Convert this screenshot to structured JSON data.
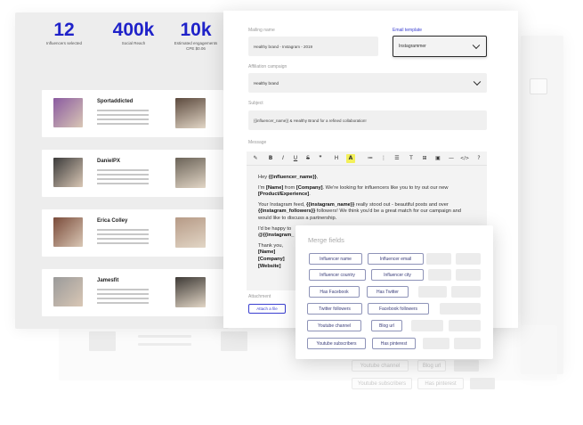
{
  "stats": [
    {
      "value": "12",
      "label": "Influencers selected"
    },
    {
      "value": "400k",
      "label": "Social Reach"
    },
    {
      "value": "10k",
      "label": "Estimated engagements"
    },
    {
      "value": "",
      "label": "CPE $0.06"
    }
  ],
  "influencers": [
    {
      "name": "Sportaddicted",
      "photo_color": "#8a5aa0",
      "post_color": "#5c4a3e"
    },
    {
      "name": "DanielPX",
      "photo_color": "#3b3b3b",
      "post_color": "#6b6358"
    },
    {
      "name": "Erica Colley",
      "photo_color": "#7a4b3a",
      "post_color": "#b69a86"
    },
    {
      "name": "Jamesfit",
      "photo_color": "#9a9a9a",
      "post_color": "#3e3a36"
    }
  ],
  "form": {
    "mailing_name_label": "Mailing name",
    "mailing_name_value": "Healthy brand - Instagram - 2019",
    "email_template_label": "Email template",
    "email_template_value": "Instagrammer",
    "affiliation_label": "Affiliation campaign",
    "affiliation_value": "Healthy brand",
    "subject_label": "Subject",
    "subject_value": "{{influencer_name}} & Healthy Brand for a refined collaboration!",
    "message_label": "Message",
    "attachment_label": "Attachment",
    "attach_button": "Attach a file"
  },
  "toolbar": [
    "✎",
    "B",
    "I",
    "U",
    "S",
    "❞",
    "H",
    "A",
    "≔",
    "⋮",
    "☰",
    "T",
    "⊞",
    "▣",
    "—",
    "</>",
    "?"
  ],
  "message": {
    "greeting_prefix": "Hey ",
    "greeting_var": "{{influencer_name}}",
    "greeting_suffix": ",",
    "p1_a": "I'm ",
    "p1_name": "[Name]",
    "p1_b": " from ",
    "p1_company": "[Company]",
    "p1_c": ". We're looking for influencers like you to try out our new ",
    "p1_product": "[Product/Experience]",
    "p1_d": ".",
    "p2_a": "Your Instagram feed, ",
    "p2_var": "{{instagram_name}}",
    "p2_b": " really stood out - beautiful posts and over ",
    "p2_var2": "{{instagram_followers}}",
    "p2_c": " followers! We think you'd be a great match for our campaign and would like to discuss a partnership.",
    "p3_a": "I'd be happy to",
    "p3_var": "@{{instagram_",
    "thanks": "Thank you,",
    "sig_name": "[Name]",
    "sig_company": "[Company]",
    "sig_website": "[Website]"
  },
  "merge": {
    "title": "Merge fields",
    "chips": [
      "Influencer name",
      "Influencer email",
      "Influencer country",
      "Influencer city",
      "Has Facebook",
      "Has Twitter",
      "Twitter followers",
      "Facebook followers",
      "Youtube channel",
      "Blog url",
      "Youtube subscribers",
      "Has pinterest"
    ]
  },
  "ghost": {
    "chip1": "Youtube channel",
    "chip2": "Blog url",
    "chip3": "Youtube subscribers",
    "chip4": "Has pinterest"
  }
}
